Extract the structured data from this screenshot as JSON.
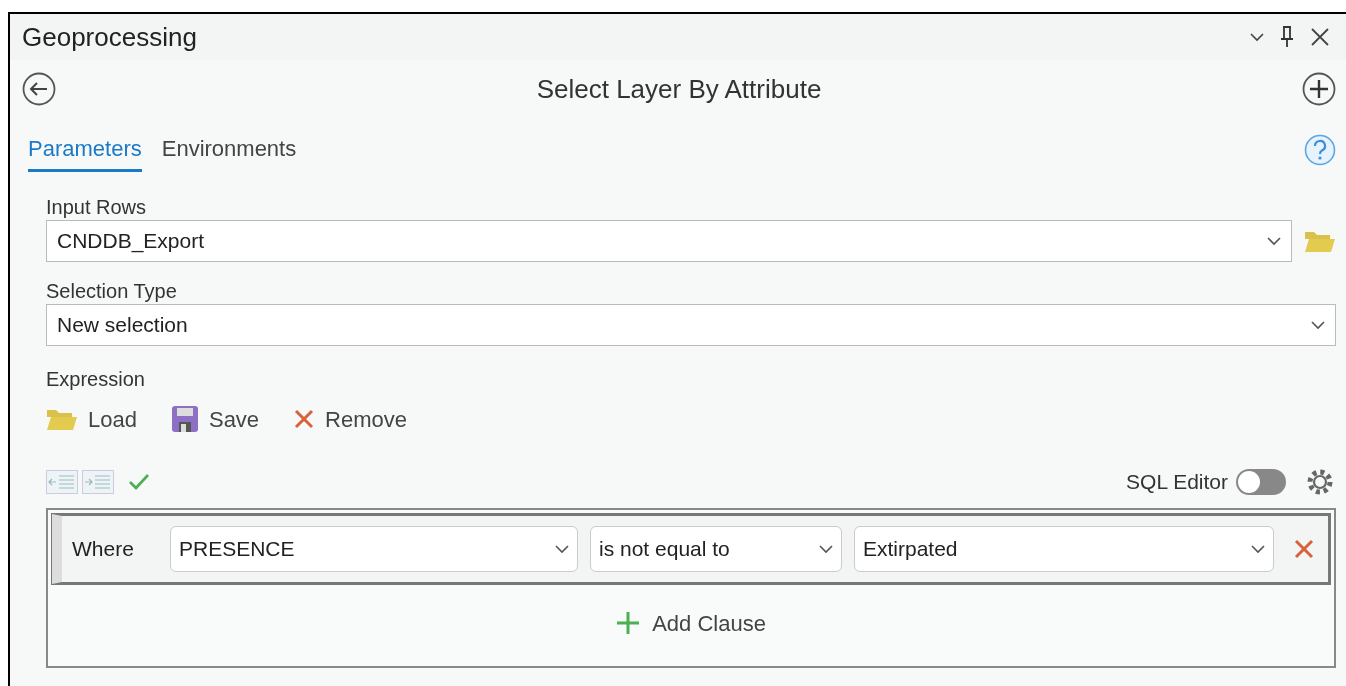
{
  "window": {
    "title": "Geoprocessing"
  },
  "tool": {
    "title": "Select Layer By Attribute"
  },
  "tabs": [
    {
      "label": "Parameters",
      "selected": true
    },
    {
      "label": "Environments",
      "selected": false
    }
  ],
  "parameters": [
    {
      "label": "Input Rows",
      "value": "CNDDB_Export",
      "browse": true
    },
    {
      "label": "Selection Type",
      "value": "New selection",
      "browse": false
    }
  ],
  "expression": {
    "label": "Expression",
    "actions": [
      {
        "kind": "load",
        "label": "Load"
      },
      {
        "kind": "save",
        "label": "Save"
      },
      {
        "kind": "remove",
        "label": "Remove"
      }
    ],
    "sql_editor": {
      "label": "SQL Editor",
      "on": false
    },
    "clauses": [
      {
        "keyword": "Where",
        "field": "PRESENCE",
        "operator": "is not equal to",
        "value": "Extirpated"
      }
    ],
    "add_clause": "Add Clause"
  }
}
